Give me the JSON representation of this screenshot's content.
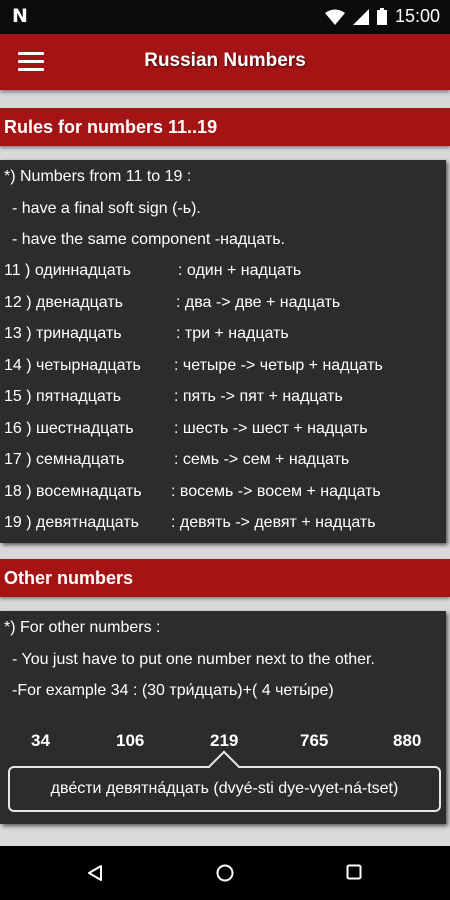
{
  "status_bar": {
    "time": "15:00",
    "n_badge": "N"
  },
  "app_bar": {
    "title": "Russian Numbers"
  },
  "section1": {
    "title": "Rules for numbers 11..19",
    "intro": [
      "*) Numbers from 11 to 19 :",
      "  - have a final soft sign (-ь).",
      "  - have the same component -надцать."
    ],
    "rows": [
      {
        "n": "11 ) одиннадцать",
        "r": ": один + надцать"
      },
      {
        "n": "12 ) двенадцать",
        "r": ": два -> две + надцать"
      },
      {
        "n": "13 ) тринадцать",
        "r": ": три + надцать"
      },
      {
        "n": "14 ) четырнадцать",
        "r": ":  четыре -> четыр + надцать"
      },
      {
        "n": "15 )  пятнадцать",
        "r": ":  пять -> пят + надцать"
      },
      {
        "n": "16 ) шестнадцать",
        "r": ": шесть -> шест + надцать"
      },
      {
        "n": "17 ) семнадцать",
        "r": ":  семь -> сем + надцать"
      },
      {
        "n": "18 ) восемнадцать",
        "r": ":  восемь -> восем + надцать"
      },
      {
        "n": "19 ) девятнадцать",
        "r": ": девять -> девят + надцать"
      }
    ]
  },
  "section2": {
    "title": "Other numbers",
    "lines": [
      "*) For other numbers :",
      "  - You just have to put one number next to the other.",
      "  -For example 34 : (30 три́дцать)+( 4 четы́ре)"
    ],
    "numbers": [
      "34",
      "106",
      "219",
      "765",
      "880"
    ],
    "selected_index": 2,
    "translation": "две́сти девятна́дцать (dvyé-sti dye-vyet-ná-tset)"
  },
  "colors": {
    "accent": "#a51414",
    "panel": "#2c2c2c",
    "background": "#d9d9d9"
  },
  "icons": [
    "menu-icon",
    "wifi-icon",
    "signal-icon",
    "battery-icon",
    "back-icon",
    "home-icon",
    "recents-icon"
  ]
}
